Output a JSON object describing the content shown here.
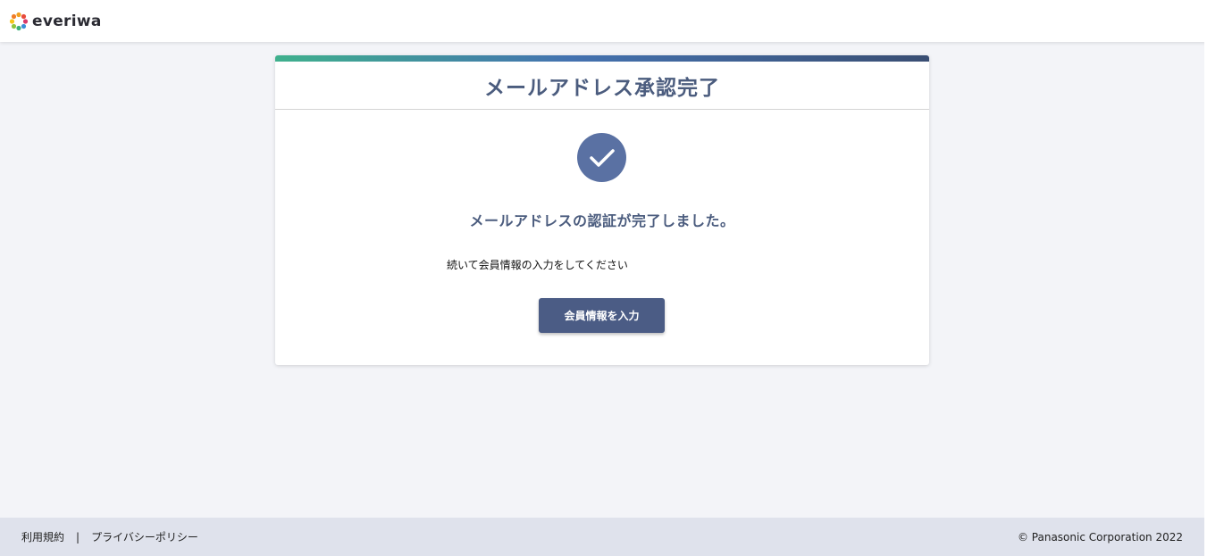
{
  "header": {
    "logo_text": "everiwa"
  },
  "card": {
    "title": "メールアドレス承認完了",
    "message": "メールアドレスの認証が完了しました。",
    "subtext": "続いて会員情報の入力をしてください",
    "button_label": "会員情報を入力"
  },
  "footer": {
    "terms_label": "利用規約",
    "separator": "|",
    "privacy_label": "プライバシーポリシー",
    "copyright": "© Panasonic Corporation 2022"
  },
  "colors": {
    "accent": "#4b5c85",
    "title": "#4b5c7e",
    "check_circle": "#5a71a3",
    "gradient_start": "#3fb08d",
    "gradient_end": "#3a4e73",
    "footer_bg": "#dfe2ec"
  }
}
